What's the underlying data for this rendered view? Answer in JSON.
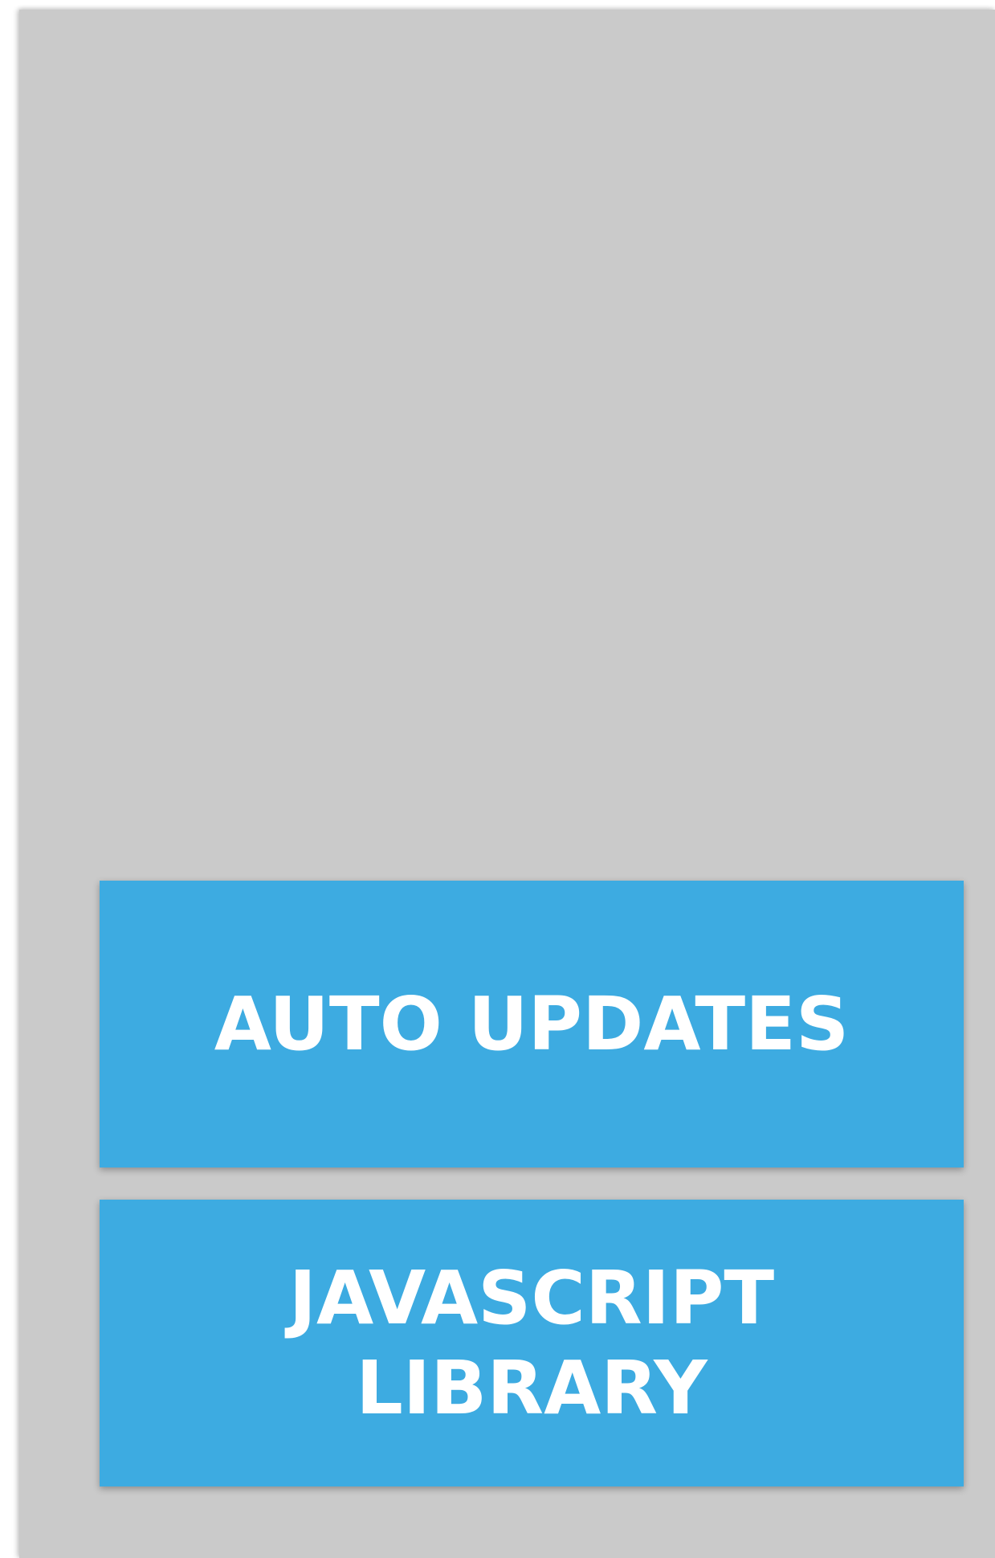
{
  "blocks": [
    {
      "label": "AUTO UPDATES",
      "color": "#3dabe1"
    },
    {
      "label_lines": [
        "JAVASCRIPT",
        "LIBRARY"
      ],
      "color": "#3dabe1"
    }
  ],
  "colors": {
    "panel": "#cacaca",
    "block": "#3dabe1",
    "text": "#ffffff"
  }
}
